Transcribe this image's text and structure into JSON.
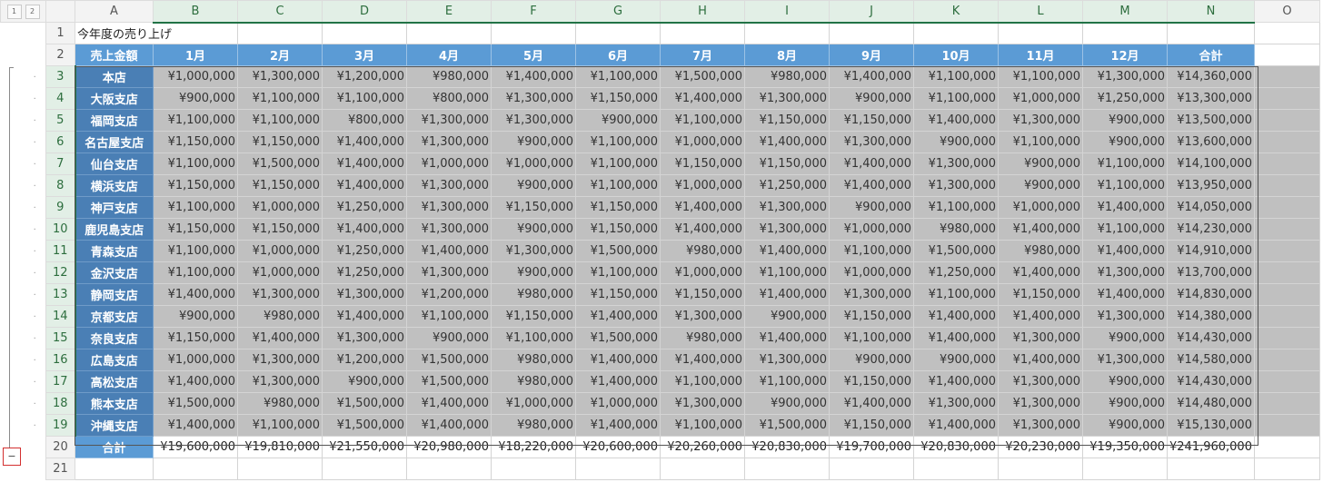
{
  "outline_levels": [
    "1",
    "2"
  ],
  "collapse_symbol": "−",
  "columns": [
    "A",
    "B",
    "C",
    "D",
    "E",
    "F",
    "G",
    "H",
    "I",
    "J",
    "K",
    "L",
    "M",
    "N",
    "O"
  ],
  "title": "今年度の売り上げ",
  "header": [
    "売上金額",
    "1月",
    "2月",
    "3月",
    "4月",
    "5月",
    "6月",
    "7月",
    "8月",
    "9月",
    "10月",
    "11月",
    "12月",
    "合計"
  ],
  "rows": [
    {
      "branch": "本店",
      "values": [
        "¥1,000,000",
        "¥1,300,000",
        "¥1,200,000",
        "¥980,000",
        "¥1,400,000",
        "¥1,100,000",
        "¥1,500,000",
        "¥980,000",
        "¥1,400,000",
        "¥1,100,000",
        "¥1,100,000",
        "¥1,300,000",
        "¥14,360,000"
      ]
    },
    {
      "branch": "大阪支店",
      "values": [
        "¥900,000",
        "¥1,100,000",
        "¥1,100,000",
        "¥800,000",
        "¥1,300,000",
        "¥1,150,000",
        "¥1,400,000",
        "¥1,300,000",
        "¥900,000",
        "¥1,100,000",
        "¥1,000,000",
        "¥1,250,000",
        "¥13,300,000"
      ]
    },
    {
      "branch": "福岡支店",
      "values": [
        "¥1,100,000",
        "¥1,100,000",
        "¥800,000",
        "¥1,300,000",
        "¥1,300,000",
        "¥900,000",
        "¥1,100,000",
        "¥1,150,000",
        "¥1,150,000",
        "¥1,400,000",
        "¥1,300,000",
        "¥900,000",
        "¥13,500,000"
      ]
    },
    {
      "branch": "名古屋支店",
      "values": [
        "¥1,150,000",
        "¥1,150,000",
        "¥1,400,000",
        "¥1,300,000",
        "¥900,000",
        "¥1,100,000",
        "¥1,000,000",
        "¥1,400,000",
        "¥1,300,000",
        "¥900,000",
        "¥1,100,000",
        "¥900,000",
        "¥13,600,000"
      ]
    },
    {
      "branch": "仙台支店",
      "values": [
        "¥1,100,000",
        "¥1,500,000",
        "¥1,400,000",
        "¥1,000,000",
        "¥1,000,000",
        "¥1,100,000",
        "¥1,150,000",
        "¥1,150,000",
        "¥1,400,000",
        "¥1,300,000",
        "¥900,000",
        "¥1,100,000",
        "¥14,100,000"
      ]
    },
    {
      "branch": "横浜支店",
      "values": [
        "¥1,150,000",
        "¥1,150,000",
        "¥1,400,000",
        "¥1,300,000",
        "¥900,000",
        "¥1,100,000",
        "¥1,000,000",
        "¥1,250,000",
        "¥1,400,000",
        "¥1,300,000",
        "¥900,000",
        "¥1,100,000",
        "¥13,950,000"
      ]
    },
    {
      "branch": "神戸支店",
      "values": [
        "¥1,100,000",
        "¥1,000,000",
        "¥1,250,000",
        "¥1,300,000",
        "¥1,150,000",
        "¥1,150,000",
        "¥1,400,000",
        "¥1,300,000",
        "¥900,000",
        "¥1,100,000",
        "¥1,000,000",
        "¥1,400,000",
        "¥14,050,000"
      ]
    },
    {
      "branch": "鹿児島支店",
      "values": [
        "¥1,150,000",
        "¥1,150,000",
        "¥1,400,000",
        "¥1,300,000",
        "¥900,000",
        "¥1,150,000",
        "¥1,400,000",
        "¥1,300,000",
        "¥1,000,000",
        "¥980,000",
        "¥1,400,000",
        "¥1,100,000",
        "¥14,230,000"
      ]
    },
    {
      "branch": "青森支店",
      "values": [
        "¥1,100,000",
        "¥1,000,000",
        "¥1,250,000",
        "¥1,400,000",
        "¥1,300,000",
        "¥1,500,000",
        "¥980,000",
        "¥1,400,000",
        "¥1,100,000",
        "¥1,500,000",
        "¥980,000",
        "¥1,400,000",
        "¥14,910,000"
      ]
    },
    {
      "branch": "金沢支店",
      "values": [
        "¥1,100,000",
        "¥1,000,000",
        "¥1,250,000",
        "¥1,300,000",
        "¥900,000",
        "¥1,100,000",
        "¥1,000,000",
        "¥1,100,000",
        "¥1,000,000",
        "¥1,250,000",
        "¥1,400,000",
        "¥1,300,000",
        "¥13,700,000"
      ]
    },
    {
      "branch": "静岡支店",
      "values": [
        "¥1,400,000",
        "¥1,300,000",
        "¥1,300,000",
        "¥1,200,000",
        "¥980,000",
        "¥1,150,000",
        "¥1,150,000",
        "¥1,400,000",
        "¥1,300,000",
        "¥1,100,000",
        "¥1,150,000",
        "¥1,400,000",
        "¥14,830,000"
      ]
    },
    {
      "branch": "京都支店",
      "values": [
        "¥900,000",
        "¥980,000",
        "¥1,400,000",
        "¥1,100,000",
        "¥1,150,000",
        "¥1,400,000",
        "¥1,300,000",
        "¥900,000",
        "¥1,150,000",
        "¥1,400,000",
        "¥1,400,000",
        "¥1,300,000",
        "¥14,380,000"
      ]
    },
    {
      "branch": "奈良支店",
      "values": [
        "¥1,150,000",
        "¥1,400,000",
        "¥1,300,000",
        "¥900,000",
        "¥1,100,000",
        "¥1,500,000",
        "¥980,000",
        "¥1,400,000",
        "¥1,100,000",
        "¥1,400,000",
        "¥1,300,000",
        "¥900,000",
        "¥14,430,000"
      ]
    },
    {
      "branch": "広島支店",
      "values": [
        "¥1,000,000",
        "¥1,300,000",
        "¥1,200,000",
        "¥1,500,000",
        "¥980,000",
        "¥1,400,000",
        "¥1,400,000",
        "¥1,300,000",
        "¥900,000",
        "¥900,000",
        "¥1,400,000",
        "¥1,300,000",
        "¥14,580,000"
      ]
    },
    {
      "branch": "高松支店",
      "values": [
        "¥1,400,000",
        "¥1,300,000",
        "¥900,000",
        "¥1,500,000",
        "¥980,000",
        "¥1,400,000",
        "¥1,100,000",
        "¥1,100,000",
        "¥1,150,000",
        "¥1,400,000",
        "¥1,300,000",
        "¥900,000",
        "¥14,430,000"
      ]
    },
    {
      "branch": "熊本支店",
      "values": [
        "¥1,500,000",
        "¥980,000",
        "¥1,500,000",
        "¥1,400,000",
        "¥1,000,000",
        "¥1,000,000",
        "¥1,300,000",
        "¥900,000",
        "¥1,400,000",
        "¥1,300,000",
        "¥1,300,000",
        "¥900,000",
        "¥14,480,000"
      ]
    },
    {
      "branch": "沖縄支店",
      "values": [
        "¥1,400,000",
        "¥1,100,000",
        "¥1,500,000",
        "¥1,400,000",
        "¥980,000",
        "¥1,400,000",
        "¥1,100,000",
        "¥1,500,000",
        "¥1,150,000",
        "¥1,400,000",
        "¥1,300,000",
        "¥900,000",
        "¥15,130,000"
      ]
    }
  ],
  "total": {
    "label": "合計",
    "values": [
      "¥19,600,000",
      "¥19,810,000",
      "¥21,550,000",
      "¥20,980,000",
      "¥18,220,000",
      "¥20,600,000",
      "¥20,260,000",
      "¥20,830,000",
      "¥19,700,000",
      "¥20,830,000",
      "¥20,230,000",
      "¥19,350,000",
      "¥241,960,000"
    ]
  },
  "colors": {
    "header_blue": "#5b9bd5",
    "branch_blue": "#4a7fb5",
    "selection_gray": "#c0c0c0",
    "excel_green": "#217346"
  }
}
